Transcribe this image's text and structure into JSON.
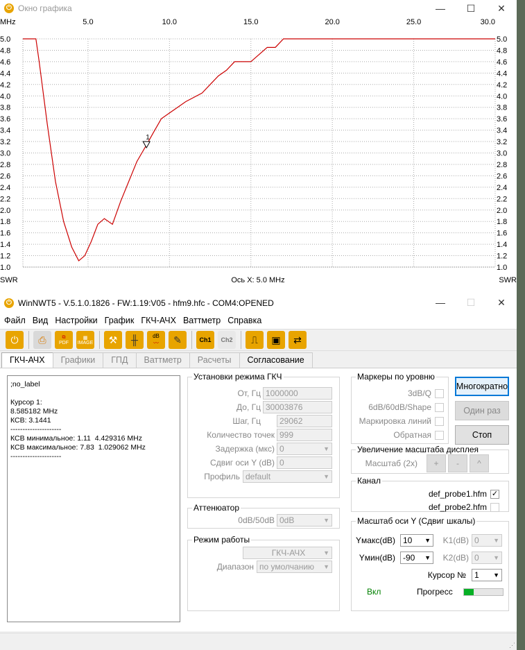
{
  "graph_window": {
    "title": "Окно графика",
    "unit_left": "MHz",
    "unit_right": "30.0",
    "x_label": "Ось X: 5.0 MHz",
    "y_label_left": "SWR",
    "y_label_right": "SWR",
    "marker_label": "1"
  },
  "chart_data": {
    "type": "line",
    "x_ticks": [
      "5.0",
      "10.0",
      "15.0",
      "20.0",
      "25.0",
      "30.0"
    ],
    "y_ticks": [
      "5.0",
      "4.8",
      "4.6",
      "4.4",
      "4.2",
      "4.0",
      "3.8",
      "3.6",
      "3.4",
      "3.2",
      "3.0",
      "2.8",
      "2.6",
      "2.4",
      "2.2",
      "2.0",
      "1.8",
      "1.6",
      "1.4",
      "1.2",
      "1.0"
    ],
    "xlim": [
      1.0,
      30.0
    ],
    "ylim": [
      1.0,
      5.0
    ],
    "grid": true,
    "series": [
      {
        "color": "#cc0000",
        "x": [
          1.0,
          1.8,
          2.0,
          2.5,
          3.0,
          3.5,
          4.0,
          4.43,
          4.8,
          5.2,
          5.6,
          6.0,
          6.5,
          7.0,
          7.5,
          8.0,
          8.59,
          9.0,
          9.5,
          10.0,
          10.5,
          11.0,
          12.0,
          12.5,
          13.0,
          13.5,
          14.0,
          15.0,
          16.0,
          16.5,
          17.0,
          20.0,
          25.0,
          30.0
        ],
        "y": [
          5.0,
          5.0,
          4.6,
          3.5,
          2.5,
          1.8,
          1.35,
          1.11,
          1.2,
          1.45,
          1.75,
          1.85,
          1.75,
          2.15,
          2.5,
          2.85,
          3.14,
          3.35,
          3.6,
          3.7,
          3.8,
          3.9,
          4.05,
          4.2,
          4.35,
          4.45,
          4.6,
          4.6,
          4.85,
          4.85,
          5.0,
          5.0,
          5.0,
          5.0
        ]
      }
    ],
    "marker": {
      "x": 8.59,
      "y": 3.14,
      "label": "1"
    }
  },
  "main_window": {
    "title": "WinNWT5 - V.5.1.0.1826 - FW:1.19:V05 - hfm9.hfc - COM4:OPENED",
    "menu": [
      "Файл",
      "Вид",
      "Настройки",
      "График",
      "ГКЧ-АЧХ",
      "Ваттметр",
      "Справка"
    ],
    "toolbar_icons": [
      "power-icon",
      "printer-icon",
      "pdf-icon",
      "image-icon",
      "probe-icon",
      "grid-cursor-icon",
      "db-icon",
      "tools-icon",
      "ch1-icon",
      "ch2-icon",
      "single-sweep-icon",
      "save-icon",
      "swap-icon"
    ],
    "toolbar_labels": {
      "pdf": "PDF",
      "image": "IMAGE",
      "ch1": "Ch1",
      "ch2": "Ch2",
      "db": "dB"
    },
    "tabs": [
      "ГКЧ-АЧХ",
      "Графики",
      "ГПД",
      "Ваттметр",
      "Расчеты",
      "Согласование"
    ],
    "output_text": ";no_label\n\nКурсор 1:\n8.585182 MHz\nКСВ: 3.1441\n---------------------\nКСВ минимальное: 1.11  4.429316 MHz\nКСВ максимальное: 7.83  1.029062 MHz\n---------------------"
  },
  "sweep": {
    "legend": "Установки режима ГКЧ",
    "from_label": "От, Гц",
    "from_value": "1000000",
    "to_label": "До, Гц",
    "to_value": "30003876",
    "step_label": "Шаг, Гц",
    "step_value": "29062",
    "points_label": "Количество точек",
    "points_value": "999",
    "delay_label": "Задержка (мкс)",
    "delay_value": "0",
    "yshift_label": "Сдвиг оси Y (dB)",
    "yshift_value": "0",
    "profile_label": "Профиль",
    "profile_value": "default"
  },
  "attenuator": {
    "legend": "Аттенюатор",
    "label": "0dB/50dB",
    "value": "0dB"
  },
  "mode": {
    "legend": "Режим работы",
    "value": "ГКЧ-АЧХ",
    "range_label": "Диапазон",
    "range_value": "по умолчанию"
  },
  "markers": {
    "legend": "Маркеры по уровню",
    "items": [
      "3dB/Q",
      "6dB/60dB/Shape",
      "Маркировка линий",
      "Обратная"
    ]
  },
  "buttons": {
    "multi": "Многократно",
    "once": "Один раз",
    "stop": "Стоп"
  },
  "zoom": {
    "legend": "Увеличение масштаба дисплея",
    "label": "Масштаб (2x)",
    "plus": "+",
    "minus": "-",
    "up": "^"
  },
  "channel": {
    "legend": "Канал",
    "probe1": "def_probe1.hfm",
    "probe2": "def_probe2.hfm",
    "probe1_checked": "✓"
  },
  "yscale": {
    "legend": "Масштаб оси Y (Сдвиг шкалы)",
    "ymax_label": "Yмакс(dB)",
    "ymax_value": "10",
    "ymin_label": "Yмин(dB)",
    "ymin_value": "-90",
    "k1_label": "K1(dB)",
    "k1_value": "0",
    "k2_label": "K2(dB)",
    "k2_value": "0",
    "cursor_label": "Курсор №",
    "cursor_value": "1",
    "on_label": "Вкл",
    "progress_label": "Прогресс",
    "progress": 0.25
  },
  "colors": {
    "trace": "#cc0000",
    "progress": "#06b025",
    "on": "#008000"
  }
}
